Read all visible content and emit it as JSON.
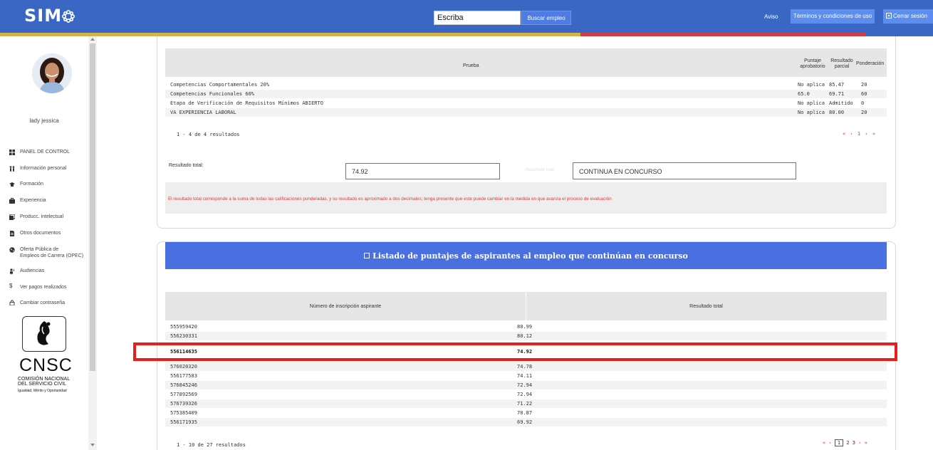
{
  "header": {
    "logo_text": "SIM",
    "search": {
      "value": "Escriba",
      "button_label": "Buscar empleo"
    },
    "aviso_label": "Aviso",
    "terms_label": "Términos y condiciones de uso",
    "logout_label": "Cerrar sesión",
    "colors": {
      "bar": "#3a66c4",
      "gold": "#d5b24a",
      "red": "#d13a48"
    }
  },
  "sidebar": {
    "username": "lady jessica",
    "items": [
      {
        "label": "PANEL DE CONTROL",
        "icon": "dashboard-icon"
      },
      {
        "label": "Información personal",
        "icon": "people-icon"
      },
      {
        "label": "Formación",
        "icon": "graduation-cap-icon"
      },
      {
        "label": "Experiencia",
        "icon": "briefcase-icon"
      },
      {
        "label": "Producc. intelectual",
        "icon": "book-icon"
      },
      {
        "label": "Otros documentos",
        "icon": "document-icon"
      },
      {
        "label": "Oferta Pública de",
        "label2": "Empleos de Carrera (OPEC)",
        "icon": "globe-icon"
      },
      {
        "label": "Audiencias",
        "icon": "audience-icon"
      },
      {
        "label": "Ver pagos realizados",
        "icon": "dollar-icon"
      },
      {
        "label": "Cambiar contraseña",
        "icon": "lock-icon"
      }
    ],
    "org": {
      "name": "CNSC",
      "line1": "COMISIÓN NACIONAL",
      "line2": "DEL SERVICIO CIVIL",
      "motto": "Igualdad, Mérito y Oportunidad"
    }
  },
  "results": {
    "headers": {
      "prueba": "Prueba",
      "puntaje": "Puntaje aprobatorio",
      "resultado": "Resultado parcial",
      "ponderacion": "Ponderación"
    },
    "rows": [
      {
        "prueba": "Competencias Comportamentales 20%",
        "puntaje": "No aplica",
        "resultado": "85.47",
        "ponderacion": "20"
      },
      {
        "prueba": "Competencias Funcionales 60%",
        "puntaje": "65.0",
        "resultado": "69.71",
        "ponderacion": "60"
      },
      {
        "prueba": "Etapa de Verificación de Requisitos Mínimos ABIERTO",
        "puntaje": "No aplica",
        "resultado": "Admitido",
        "ponderacion": "0"
      },
      {
        "prueba": "VA EXPERIENCIA LABORAL",
        "puntaje": "No aplica",
        "resultado": "80.00",
        "ponderacion": "20"
      }
    ],
    "count": "1 - 4 de 4 resultados",
    "pager": "« ‹ 1 › »",
    "total_label": "Resultado total:",
    "total_value": "74.92",
    "state_label": "Resultado total:",
    "state_value": "CONTINUA EN CONCURSO",
    "notice": "El resultado total corresponde a la suma de todas las calificaciones ponderadas, y su resultado es aproximado a dos decimales; tenga presente que este puede cambiar en la medida en que avanza el proceso de evaluación"
  },
  "ranking": {
    "title": "Listado de puntajes de aspirantes al empleo que continúan en concurso",
    "headers": {
      "numero": "Número de inscripción aspirante",
      "resultado": "Resultado total"
    },
    "rows": [
      {
        "numero": "555959420",
        "resultado": "80.99"
      },
      {
        "numero": "556230331",
        "resultado": "80.12"
      },
      {
        "numero": "556114635",
        "resultado": "74.92"
      },
      {
        "numero": "576020320",
        "resultado": "74.78"
      },
      {
        "numero": "556177583",
        "resultado": "74.11"
      },
      {
        "numero": "576845246",
        "resultado": "72.94"
      },
      {
        "numero": "577892569",
        "resultado": "72.94"
      },
      {
        "numero": "576739326",
        "resultado": "71.22"
      },
      {
        "numero": "575385409",
        "resultado": "70.87"
      },
      {
        "numero": "556171935",
        "resultado": "69.92"
      }
    ],
    "count": "1 - 10 de 27 resultados",
    "pager": {
      "first": "«",
      "prev": "‹",
      "current": "1",
      "p2": "2",
      "p3": "3",
      "next": "›",
      "last": "»"
    }
  }
}
